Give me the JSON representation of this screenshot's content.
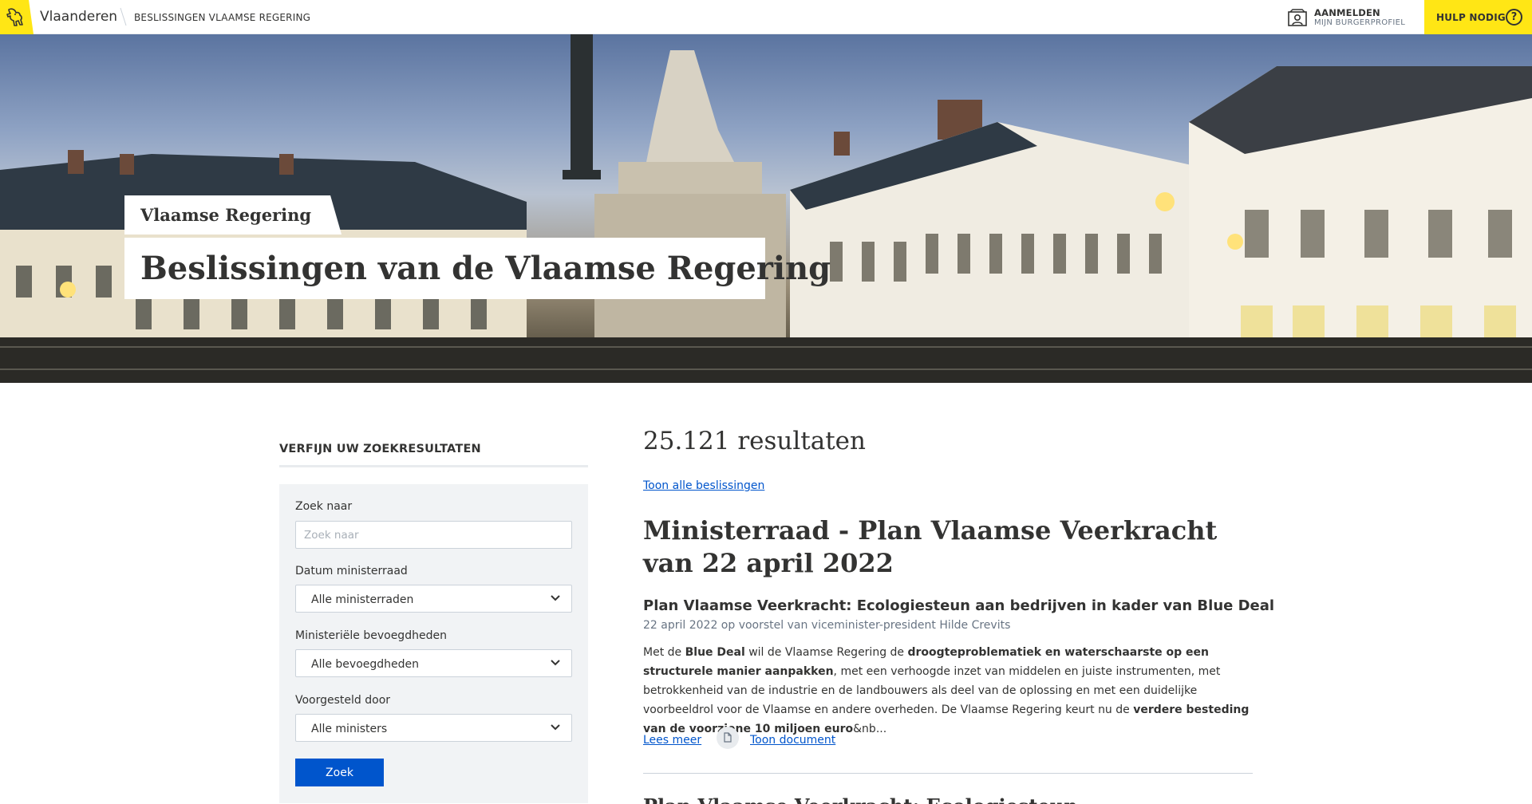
{
  "header": {
    "brand": "Vlaanderen",
    "breadcrumb": "BESLISSINGEN VLAAMSE REGERING",
    "login_title": "AANMELDEN",
    "login_sub": "MIJN BURGERPROFIEL",
    "help_label": "HULP NODIG",
    "help_symbol": "?",
    "accent_color": "#ffe615"
  },
  "hero": {
    "subtitle": "Vlaamse Regering",
    "title": "Beslissingen van de Vlaamse Regering"
  },
  "filters": {
    "heading": "VERFIJN UW ZOEKRESULTATEN",
    "search_label": "Zoek naar",
    "search_placeholder": "Zoek naar",
    "search_value": "",
    "date_label": "Datum ministerraad",
    "date_value": "Alle ministerraden",
    "competence_label": "Ministeriële bevoegdheden",
    "competence_value": "Alle bevoegdheden",
    "proposed_label": "Voorgesteld door",
    "proposed_value": "Alle ministers",
    "submit_label": "Zoek",
    "button_color": "#0055cc"
  },
  "results": {
    "count": "25.121 resultaten",
    "show_all": "Toon alle beslissingen",
    "group_title": "Ministerraad - Plan Vlaamse Veerkracht van 22 april 2022",
    "items": [
      {
        "title": "Plan Vlaamse Veerkracht: Ecologiesteun aan bedrijven in kader van Blue Deal",
        "meta": "22 april 2022 op voorstel van viceminister-president Hilde Crevits",
        "body": {
          "p1": "Met de ",
          "b1": "Blue Deal",
          "p2": "  wil de Vlaamse Regering de ",
          "b2": "droogteproblematiek en waterschaarste op een structurele manier aanpakken",
          "p3": ", met een verhoogde inzet van middelen en juiste instrumenten, met betrokkenheid van de industrie en de landbouwers als deel van de oplossing en met een duidelijke voorbeeldrol voor de Vlaamse en andere overheden. De Vlaamse Regering keurt nu de ",
          "b3": "verdere besteding van de voorziene 10 miljoen euro",
          "p4": "&nb..."
        },
        "read_more": "Lees meer",
        "document_icon": "document-icon",
        "show_document": "Toon document"
      }
    ],
    "next_item_title": "Plan Vlaamse Veerkracht: Ecologiesteun aan bedrijven in het kader van de Blue Deal"
  }
}
